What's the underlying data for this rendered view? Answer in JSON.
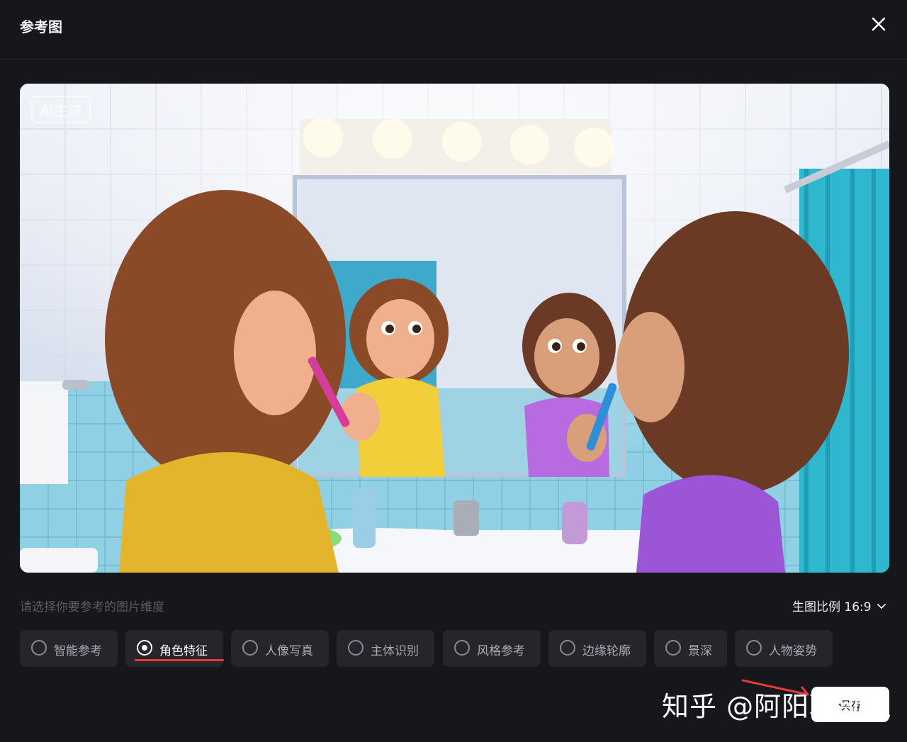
{
  "dialog": {
    "title": "参考图",
    "close_icon": "close-icon"
  },
  "preview": {
    "badge": "AI生成",
    "alt": "bathroom scene: two girls brushing teeth in front of a mirror"
  },
  "controls": {
    "hint": "请选择你要参考的图片维度",
    "ratio_label": "生图比例 16:9",
    "ratio_icon": "chevron-down-icon"
  },
  "dimensions": [
    {
      "label": "智能参考",
      "selected": false
    },
    {
      "label": "角色特征",
      "selected": true
    },
    {
      "label": "人像写真",
      "selected": false
    },
    {
      "label": "主体识别",
      "selected": false
    },
    {
      "label": "风格参考",
      "selected": false
    },
    {
      "label": "边缘轮廓",
      "selected": false
    },
    {
      "label": "景深",
      "selected": false
    },
    {
      "label": "人物姿势",
      "selected": false
    }
  ],
  "footer": {
    "save_label": "保存",
    "watermark": "知乎 @阿阳聊副业"
  },
  "colors": {
    "background": "#16171b",
    "chip": "#25262c",
    "accent_underline": "#e63b3b"
  }
}
